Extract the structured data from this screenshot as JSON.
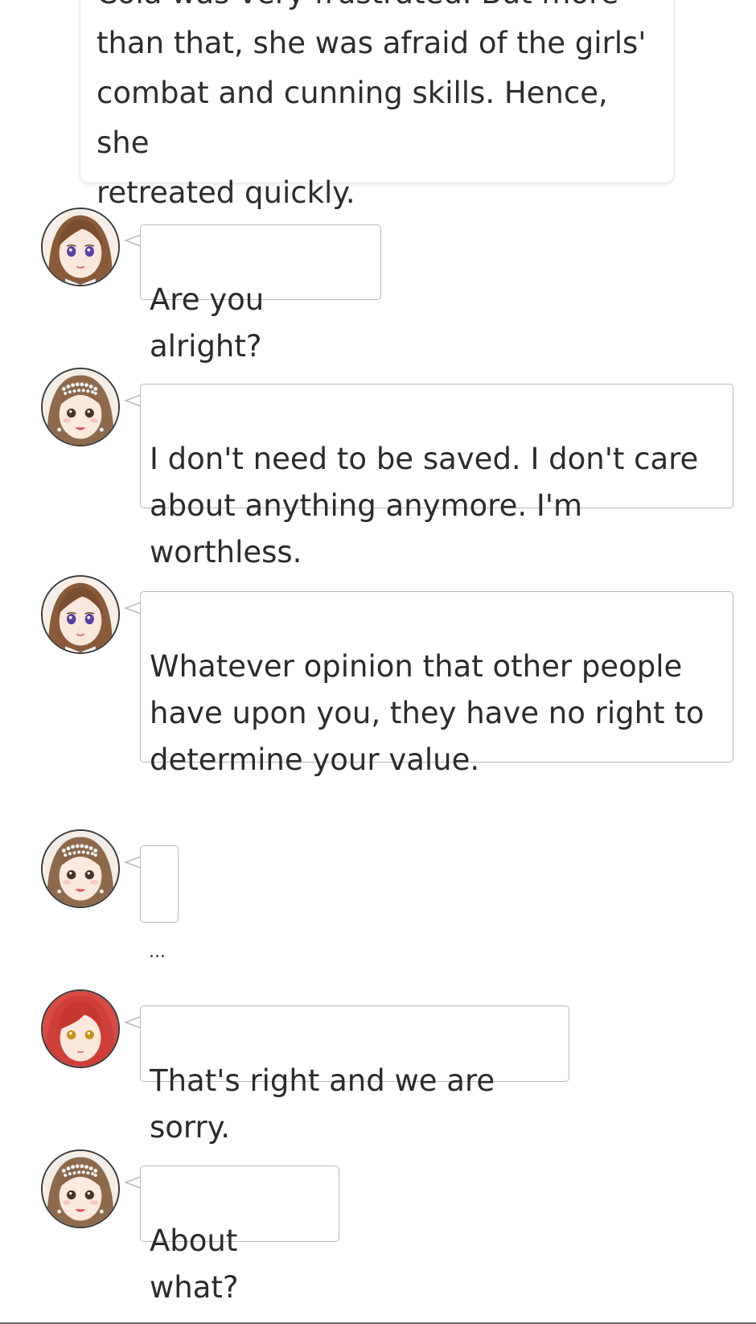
{
  "narration": {
    "lines": [
      "Cola was very frustrated. But more",
      "than that, she was afraid of the girls'",
      "combat and cunning skills. Hence, she",
      "retreated quickly."
    ]
  },
  "messages": [
    {
      "speaker_icon": "brown-hair-purple-eyes-avatar",
      "text": "Are you alright?"
    },
    {
      "speaker_icon": "pearl-headband-girl-avatar",
      "text": "I don't need to be saved. I don't care\nabout anything anymore. I'm worthless."
    },
    {
      "speaker_icon": "brown-hair-purple-eyes-avatar",
      "text": "Whatever opinion that other people\nhave upon you, they have no right to\ndetermine your value."
    },
    {
      "speaker_icon": "pearl-headband-girl-avatar",
      "text": "..."
    },
    {
      "speaker_icon": "red-hair-gold-eyes-avatar",
      "text": "That's right and we are sorry."
    },
    {
      "speaker_icon": "pearl-headband-girl-avatar",
      "text": "About what?"
    }
  ],
  "colors": {
    "bubble_border": "#b9b9b9",
    "card_border": "#e6e6e6",
    "text": "#2b2b2b"
  }
}
